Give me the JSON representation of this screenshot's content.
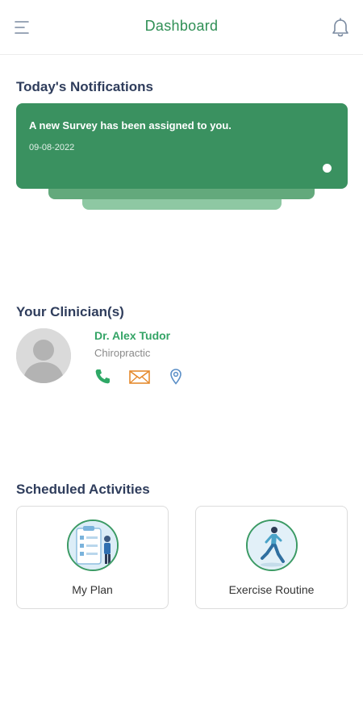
{
  "header": {
    "title": "Dashboard",
    "menu_icon": "menu-icon",
    "bell_icon": "bell-icon"
  },
  "notifications": {
    "section_title": "Today's Notifications",
    "items": [
      {
        "message": "A new Survey has been assigned to you.",
        "date": "09-08-2022"
      }
    ]
  },
  "clinicians": {
    "section_title": "Your Clinician(s)",
    "items": [
      {
        "name": "Dr. Alex Tudor",
        "specialty": "Chiropractic",
        "contact_icons": [
          "phone-icon",
          "mail-icon",
          "location-icon"
        ]
      }
    ]
  },
  "activities": {
    "section_title": "Scheduled Activities",
    "items": [
      {
        "label": "My Plan",
        "icon": "plan-checklist-icon"
      },
      {
        "label": "Exercise Routine",
        "icon": "running-person-icon"
      }
    ]
  },
  "colors": {
    "brand_green": "#3a9160",
    "title_green": "#2f8f55",
    "name_green": "#34a466",
    "heading_navy": "#2f3d5c",
    "mail_orange": "#e58a2e",
    "location_blue": "#5b8fc7"
  }
}
